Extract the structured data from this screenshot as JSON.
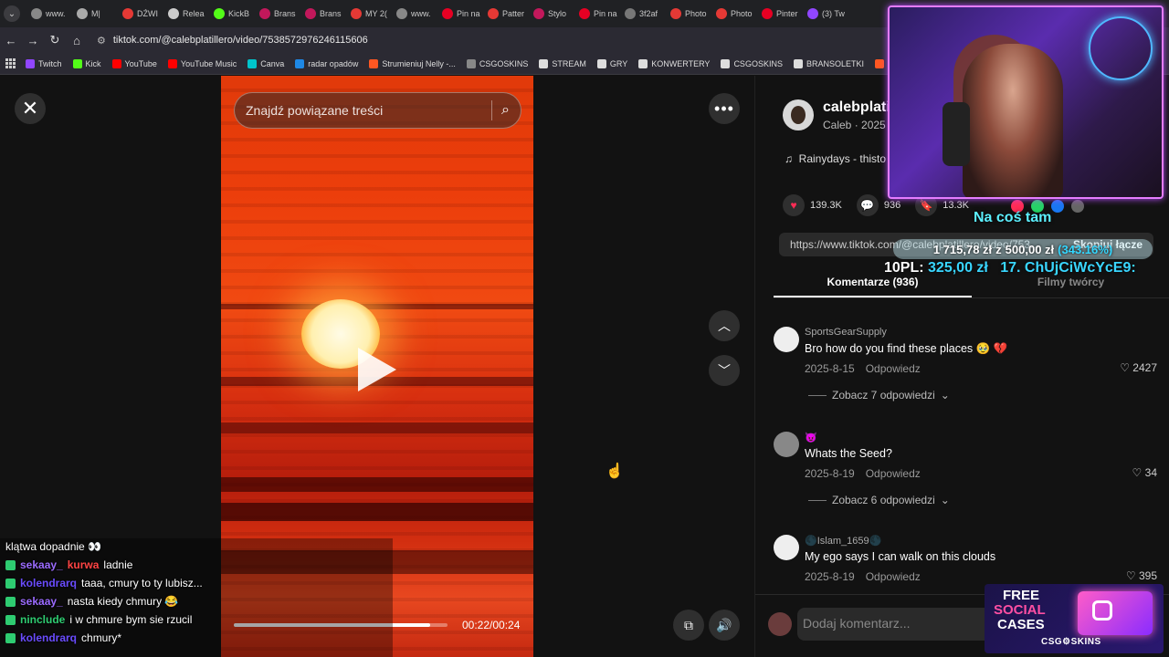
{
  "browser": {
    "tabs": [
      "www.",
      "M|",
      "DŹWI",
      "Relea",
      "KickB",
      "Brans",
      "Brans",
      "MY 2(",
      "www.",
      "Pin na",
      "Patter",
      "Stylo",
      "Pin na",
      "3f2af",
      "Photo",
      "Photo",
      "Pinter",
      "(3) Tw"
    ],
    "url": "tiktok.com/@calebplatillero/video/7538572976246115606",
    "bookmarks": [
      "Twitch",
      "Kick",
      "YouTube",
      "YouTube Music",
      "Canva",
      "radar opadów",
      "Strumieniuj Nelly -...",
      "CSGOSKINS",
      "STREAM",
      "GRY",
      "KONWERTERY",
      "CSGOSKINS",
      "BRANSOLETKI",
      "Ustawienia strumien..."
    ]
  },
  "video": {
    "search_placeholder": "Znajdź powiązane treści",
    "time": "00:22/00:24",
    "progress": 0.92
  },
  "author": {
    "name": "calebplati",
    "sub": "Caleb · 2025",
    "music": "Rainydays - thisto"
  },
  "actions": {
    "likes": "139.3K",
    "comments": "936",
    "saves": "13.3K"
  },
  "link": {
    "url": "https://www.tiktok.com/@calebplatillero/video/753...",
    "copy": "Skopiuj łącze"
  },
  "panel_tabs": {
    "comments": "Komentarze (936)",
    "videos": "Filmy twórcy"
  },
  "comments": [
    {
      "user": "SportsGearSupply",
      "text": "Bro how do you find these places 🥹 💔",
      "date": "2025-8-15",
      "reply": "Odpowiedz",
      "likes": "2427",
      "more": "Zobacz 7 odpowiedzi"
    },
    {
      "user": "😈",
      "text": "Whats the Seed?",
      "date": "2025-8-19",
      "reply": "Odpowiedz",
      "likes": "34",
      "more": "Zobacz 6 odpowiedzi"
    },
    {
      "user": "🌑Islam_1659🌑",
      "text": "My ego says I can walk on this clouds",
      "date": "2025-8-19",
      "reply": "Odpowiedz",
      "likes": "395",
      "more": ""
    }
  ],
  "add_comment_placeholder": "Dodaj komentarz...",
  "stream": {
    "na_cos": "Na coś tam",
    "donation_current": "1 715,78 zł",
    "donation_sep": "z",
    "donation_goal": "500,00 zł",
    "donation_pct": "(343.16%)",
    "ticker_code": "10PL:",
    "ticker_amount": "325,00 zł",
    "ticker_next": "17. ChUjCiWcYcE9:",
    "chat": [
      {
        "user": "",
        "text": "klątwa dopadnie 👀",
        "color": "#ffffff"
      },
      {
        "user": "sekaay_",
        "text": "ladnie",
        "color": "#9b6bff",
        "extra": "kurwa"
      },
      {
        "user": "kolendrarq",
        "text": "taaa, cmury to ty lubisz...",
        "color": "#6a4cff"
      },
      {
        "user": "sekaay_",
        "text": "nasta kiedy chmury 😂",
        "color": "#9b6bff"
      },
      {
        "user": "ninclude",
        "text": "i w chmure bym sie rzucil",
        "color": "#2ecc71"
      },
      {
        "user": "kolendrarq",
        "text": "chmury*",
        "color": "#6a4cff"
      }
    ],
    "promo": {
      "l1": "FREE",
      "l2": "SOCIAL",
      "l3": "CASES",
      "brand": "CSG⚙SKINS"
    }
  },
  "colors": {
    "accent": "#fe2c55",
    "panel_bg": "#121212",
    "video_red": "#e13a0a"
  }
}
